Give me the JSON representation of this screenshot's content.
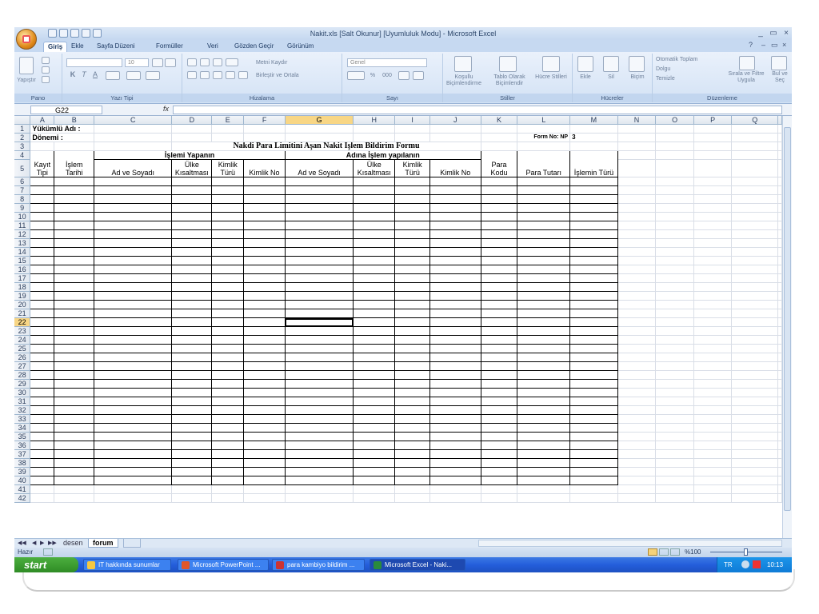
{
  "window": {
    "title": "Nakit.xls  [Salt Okunur]  [Uyumluluk Modu] - Microsoft Excel",
    "controls": [
      "_",
      "▭",
      "×"
    ]
  },
  "ribbon_tabs": [
    "Giriş",
    "Ekle",
    "Sayfa Düzeni",
    "Formüller",
    "Veri",
    "Gözden Geçir",
    "Görünüm"
  ],
  "ribbon": {
    "clipboard": {
      "label": "Pano",
      "paste": "Yapıştır"
    },
    "font": {
      "label": "Yazı Tipi",
      "size": "10",
      "bold": "K",
      "italic": "T",
      "underline": "A"
    },
    "alignment": {
      "label": "Hizalama",
      "wrap": "Metni Kaydır",
      "merge": "Birleştir ve Ortala"
    },
    "number": {
      "label": "Sayı",
      "format": "Genel",
      "percent": "%",
      "comma": "000"
    },
    "styles": {
      "label": "Stiller",
      "cond": "Koşullu Biçimlendirme",
      "table": "Tablo Olarak Biçimlendir",
      "cell": "Hücre Stilleri"
    },
    "cells": {
      "label": "Hücreler",
      "insert": "Ekle",
      "delete": "Sil",
      "format": "Biçim"
    },
    "editing": {
      "label": "Düzenleme",
      "autosum": "Otomatik Toplam",
      "fill": "Dolgu",
      "clear": "Temizle",
      "sort": "Sırala ve Filtre Uygula",
      "find": "Bul ve Seç"
    }
  },
  "formula_bar": {
    "name_box": "G22",
    "fx": "fx",
    "value": ""
  },
  "columns": [
    "A",
    "B",
    "C",
    "D",
    "E",
    "F",
    "G",
    "H",
    "I",
    "J",
    "K",
    "L",
    "M",
    "N",
    "O",
    "P",
    "Q"
  ],
  "selected_cell": "G22",
  "cells": {
    "a1": "Yükümlü Adı  :",
    "a2": "Dönemi       :",
    "form_no": "Form No: NP",
    "form_no_val": "3",
    "title": "Nakdi Para Limitini Aşan Nakit İşlem Bildirim Formu",
    "group1": "İşlemi Yapanın",
    "group2": "Adına İşlem yapılanın",
    "h_kayit": "Kayıt Tipi",
    "h_islem": "İşlem Tarihi",
    "h_ad1": "Ad ve Soyadı",
    "h_ulke1": "Ülke Kısaltması",
    "h_kimlik1": "Kimlik Türü",
    "h_kno1": "Kimlik No",
    "h_ad2": "Ad ve Soyadı",
    "h_ulke2": "Ülke Kısaltması",
    "h_kimlik2": "Kimlik Türü",
    "h_kno2": "Kimlik No",
    "h_para": "Para Kodu",
    "h_tutar": "Para Tutarı",
    "h_tur": "İşlemin Türü"
  },
  "sheets": [
    "desen",
    "forum"
  ],
  "active_sheet": "forum",
  "status": {
    "text": "Hazır",
    "zoom": "%100"
  },
  "taskbar": {
    "start": "start",
    "items": [
      "IT hakkında sunumlar",
      "Microsoft PowerPoint ...",
      "para kambiyo bildirim ...",
      "Microsoft Excel - Naki..."
    ],
    "lang": "TR",
    "clock": "10:13"
  }
}
